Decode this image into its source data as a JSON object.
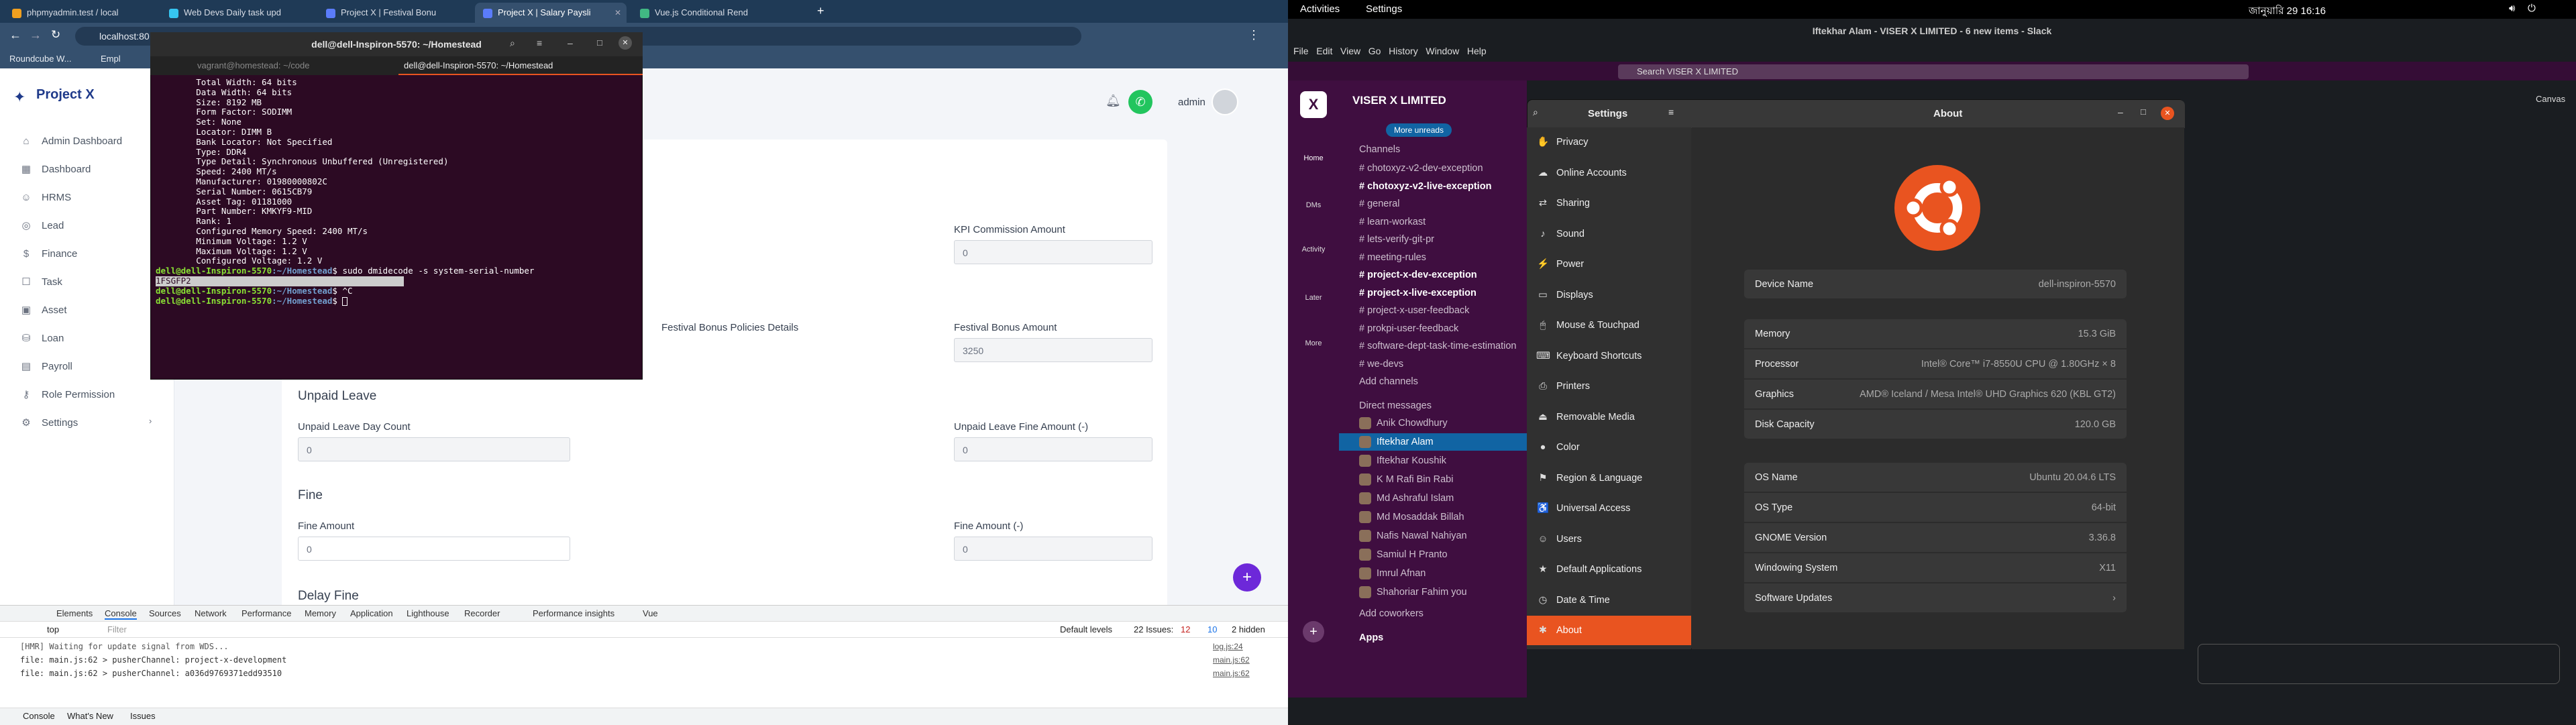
{
  "browser": {
    "tabs": [
      {
        "title": "phpmyadmin.test / local"
      },
      {
        "title": "Web Devs Daily task upd"
      },
      {
        "title": "Project X | Festival Bonu"
      },
      {
        "title": "Project X | Salary Paysli"
      },
      {
        "title": "Vue.js Conditional Rend"
      }
    ],
    "url": "localhost:80",
    "bookmarks": [
      "Roundcube W...",
      "Empl"
    ]
  },
  "app": {
    "brand": "Project X",
    "nav": [
      "Admin Dashboard",
      "Dashboard",
      "HRMS",
      "Lead",
      "Finance",
      "Task",
      "Asset",
      "Loan",
      "Payroll",
      "Role Permission",
      "Settings"
    ],
    "user": "admin",
    "form": {
      "kpi_label": "KPI Commission Amount",
      "kpi_value": "0",
      "festival_policies_label": "Festival Bonus Policies Details",
      "festival_amount_label": "Festival Bonus Amount",
      "festival_amount_value": "3250",
      "unpaid_title": "Unpaid Leave",
      "unpaid_day_label": "Unpaid Leave Day Count",
      "unpaid_day_value": "0",
      "unpaid_fine_label": "Unpaid Leave Fine Amount (-)",
      "unpaid_fine_value": "0",
      "fine_title": "Fine",
      "fine_amount_label": "Fine Amount",
      "fine_amount_value": "0",
      "fine_minus_label": "Fine Amount (-)",
      "fine_minus_value": "0",
      "delay_title": "Delay Fine"
    }
  },
  "terminal": {
    "title": "dell@dell-Inspiron-5570: ~/Homestead",
    "tab1": "vagrant@homestead: ~/code",
    "tab2": "dell@dell-Inspiron-5570: ~/Homestead",
    "lines": [
      "        Total Width: 64 bits",
      "        Data Width: 64 bits",
      "        Size: 8192 MB",
      "        Form Factor: SODIMM",
      "        Set: None",
      "        Locator: DIMM B",
      "        Bank Locator: Not Specified",
      "        Type: DDR4",
      "        Type Detail: Synchronous Unbuffered (Unregistered)",
      "        Speed: 2400 MT/s",
      "        Manufacturer: 01980000802C",
      "        Serial Number: 0615CB79",
      "        Asset Tag: 01181000",
      "        Part Number: KMKYF9-MID",
      "        Rank: 1",
      "        Configured Memory Speed: 2400 MT/s",
      "        Minimum Voltage: 1.2 V",
      "        Maximum Voltage: 1.2 V",
      "        Configured Voltage: 1.2 V"
    ],
    "prompt_user": "dell@dell-Inspiron-5570",
    "prompt_path": ":~/Homestead",
    "cmd1": "$ sudo dmidecode -s system-serial-number",
    "out1": "1FSGFP2",
    "cmd2": "$ ^C",
    "cmd3": "$ "
  },
  "devtools": {
    "tabs": [
      "Elements",
      "Console",
      "Sources",
      "Network",
      "Performance",
      "Memory",
      "Application",
      "Lighthouse",
      "Recorder",
      "Performance insights",
      "Vue"
    ],
    "filter_placeholder": "Filter",
    "levels": "Default levels",
    "issues": "22 Issues:",
    "issues_a": "12",
    "issues_b": "10",
    "hidden": "2 hidden",
    "top": "top",
    "logs": [
      {
        "text": "[HMR] Waiting for update signal from WDS...",
        "src": "log.js:24"
      },
      {
        "text": "file: main.js:62 > pusherChannel: project-x-development",
        "src": "main.js:62"
      },
      {
        "text": "file: main.js:62 > pusherChannel: a036d9769371edd93510",
        "src": "main.js:62"
      }
    ],
    "bottom_tabs": [
      "Console",
      "What's New",
      "Issues"
    ]
  },
  "ubuntu": {
    "activities": "Activities",
    "app": "Settings",
    "clock": "জানুয়ারি 29  16:16"
  },
  "slack": {
    "window_title": "Iftekhar Alam - VISER X LIMITED - 6 new items - Slack",
    "menu": [
      "File",
      "Edit",
      "View",
      "Go",
      "History",
      "Window",
      "Help"
    ],
    "search": "Search VISER X LIMITED",
    "workspace": "VISER X LIMITED",
    "more_unreads": "More unreads",
    "rail": [
      "Home",
      "DMs",
      "Activity",
      "Later",
      "More"
    ],
    "channels_header": "Channels",
    "channels": [
      {
        "name": "chotoxyz-v2-dev-exception",
        "bold": false
      },
      {
        "name": "chotoxyz-v2-live-exception",
        "bold": true
      },
      {
        "name": "general",
        "bold": false
      },
      {
        "name": "learn-workast",
        "bold": false
      },
      {
        "name": "lets-verify-git-pr",
        "bold": false
      },
      {
        "name": "meeting-rules",
        "bold": false
      },
      {
        "name": "project-x-dev-exception",
        "bold": true
      },
      {
        "name": "project-x-live-exception",
        "bold": true
      },
      {
        "name": "project-x-user-feedback",
        "bold": false
      },
      {
        "name": "prokpi-user-feedback",
        "bold": false
      },
      {
        "name": "software-dept-task-time-estimation",
        "bold": false
      },
      {
        "name": "we-devs",
        "bold": false
      }
    ],
    "add_channels": "Add channels",
    "dm_header": "Direct messages",
    "dms": [
      "Anik Chowdhury",
      "Iftekhar Alam",
      "Iftekhar Koushik",
      "K M Rafi Bin Rabi",
      "Md Ashraful Islam",
      "Md Mosaddak Billah",
      "Nafis Nawal Nahiyan",
      "Samiul H Pranto",
      "Imrul Afnan",
      "Shahoriar Fahim  you"
    ],
    "add_coworkers": "Add coworkers",
    "apps": "Apps",
    "canvas": "Canvas"
  },
  "settings": {
    "title": "Settings",
    "panel_title": "About",
    "items": [
      "Privacy",
      "Online Accounts",
      "Sharing",
      "Sound",
      "Power",
      "Displays",
      "Mouse & Touchpad",
      "Keyboard Shortcuts",
      "Printers",
      "Removable Media",
      "Color",
      "Region & Language",
      "Universal Access",
      "Users",
      "Default Applications",
      "Date & Time",
      "About"
    ],
    "device_name_label": "Device Name",
    "device_name": "dell-inspiron-5570",
    "memory_label": "Memory",
    "memory": "15.3 GiB",
    "processor_label": "Processor",
    "processor": "Intel® Core™ i7-8550U CPU @ 1.80GHz × 8",
    "graphics_label": "Graphics",
    "graphics": "AMD® Iceland / Mesa Intel® UHD Graphics 620 (KBL GT2)",
    "disk_label": "Disk Capacity",
    "disk": "120.0 GB",
    "os_name_label": "OS Name",
    "os_name": "Ubuntu 20.04.6 LTS",
    "os_type_label": "OS Type",
    "os_type": "64-bit",
    "gnome_label": "GNOME Version",
    "gnome": "3.36.8",
    "ws_label": "Windowing System",
    "ws": "X11",
    "updates_label": "Software Updates"
  },
  "colors": {
    "ubuntu_orange": "#e95420",
    "slack_purple": "#3f0e40",
    "terminal_bg": "#2c0a23",
    "brand_blue": "#1f3a8a"
  }
}
